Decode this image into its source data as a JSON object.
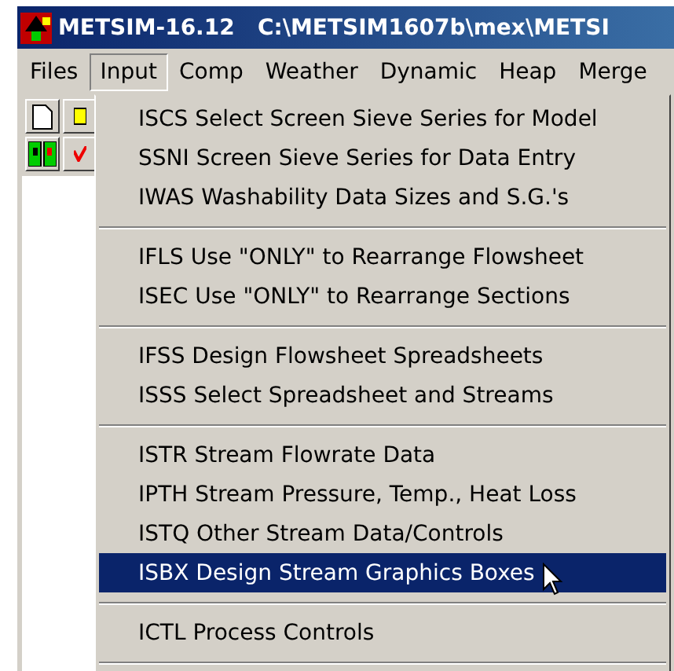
{
  "window": {
    "title": "METSIM-16.12   C:\\METSIM1607b\\mex\\METSI"
  },
  "menubar": [
    {
      "label": "Files",
      "selected": false
    },
    {
      "label": "Input",
      "selected": true
    },
    {
      "label": "Comp",
      "selected": false
    },
    {
      "label": "Weather",
      "selected": false
    },
    {
      "label": "Dynamic",
      "selected": false
    },
    {
      "label": "Heap",
      "selected": false
    },
    {
      "label": "Merge",
      "selected": false
    }
  ],
  "dropdown": [
    {
      "kind": "item",
      "label": "ISCS Select Screen Sieve Series for Model",
      "selected": false
    },
    {
      "kind": "item",
      "label": "SSNI Screen Sieve Series for Data Entry",
      "selected": false
    },
    {
      "kind": "item",
      "label": "IWAS Washability Data Sizes and S.G.'s",
      "selected": false
    },
    {
      "kind": "separator"
    },
    {
      "kind": "item",
      "label": "IFLS Use \"ONLY\" to Rearrange Flowsheet",
      "selected": false
    },
    {
      "kind": "item",
      "label": "ISEC Use \"ONLY\" to Rearrange Sections",
      "selected": false
    },
    {
      "kind": "separator"
    },
    {
      "kind": "item",
      "label": "IFSS Design Flowsheet Spreadsheets",
      "selected": false
    },
    {
      "kind": "item",
      "label": "ISSS Select Spreadsheet and Streams",
      "selected": false
    },
    {
      "kind": "separator"
    },
    {
      "kind": "item",
      "label": "ISTR Stream Flowrate Data",
      "selected": false
    },
    {
      "kind": "item",
      "label": "IPTH Stream Pressure, Temp., Heat Loss",
      "selected": false
    },
    {
      "kind": "item",
      "label": "ISTQ Other Stream Data/Controls",
      "selected": false
    },
    {
      "kind": "item",
      "label": "ISBX Design Stream Graphics Boxes",
      "selected": true
    },
    {
      "kind": "separator"
    },
    {
      "kind": "item",
      "label": "ICTL Process Controls",
      "selected": false
    },
    {
      "kind": "separator"
    }
  ]
}
